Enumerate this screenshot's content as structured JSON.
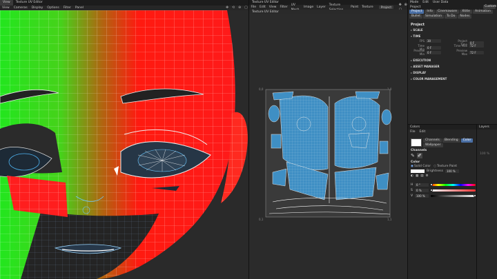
{
  "viewport": {
    "tabs": [
      "View",
      "Texture UV Editor"
    ],
    "menu": [
      "View",
      "Cameras",
      "Display",
      "Options",
      "Filter",
      "Panel"
    ],
    "label": "Perspective"
  },
  "uv_editor": {
    "title": "Texture UV Editor",
    "menu": [
      "File",
      "Edit",
      "View",
      "Filter",
      "UV Mesh",
      "Image",
      "Layer",
      "Texture Selection",
      "Paint",
      "Texture"
    ],
    "mode_select": "Project",
    "sub_label": "Texture UV Editor",
    "corners": {
      "top_left": "0,0",
      "top_right": "1,0",
      "bottom_left": "0,1",
      "bottom_right": "1,1"
    }
  },
  "attributes": {
    "top_tabs": [
      "Mode",
      "Edit",
      "User Data"
    ],
    "layout": "Custom",
    "project_label": "Project",
    "tabs": [
      "Project",
      "Info",
      "Cinemaware",
      "Xtitle",
      "Animation",
      "Bullet",
      "Simulation",
      "To Do",
      "Nodes"
    ],
    "title": "Project",
    "sections": {
      "scale": "SCALE",
      "time": "TIME",
      "execution": "EXECUTION",
      "asset_manager": "ASSET MANAGER",
      "display": "DISPLAY",
      "color_management": "COLOR MANAGEMENT"
    },
    "time_fields": [
      {
        "label": "FPS",
        "value": "30"
      },
      {
        "label": "Project Time",
        "value": "0 F"
      },
      {
        "label": "Time Min",
        "value": "0 F"
      },
      {
        "label": "Time Max",
        "value": "72 F"
      },
      {
        "label": "Preview Min",
        "value": "0 F"
      },
      {
        "label": "Preview Max",
        "value": "72 F"
      }
    ]
  },
  "colors_panel": {
    "tab": "Colors",
    "menu": [
      "File",
      "Edit"
    ],
    "buttons": [
      "Channels",
      "Blending",
      "Color"
    ],
    "wallpaper": "Wallpaper",
    "channels_label": "Channels",
    "color_label": "Color",
    "radio_solid": "Solid Color",
    "radio_texture": "Texture Paint",
    "brightness_label": "Brightness",
    "brightness_value": "100 %",
    "hue_label": "H",
    "hue_value": "0 °",
    "sat_label": "S",
    "sat_value": "0 %",
    "val_label": "V",
    "val_value": "100 %",
    "swatch_color": "#ffffff"
  },
  "layers_panel": {
    "tab": "Layers",
    "value": "100 %"
  },
  "colors": {
    "accent": "#4a6fa5",
    "uv_island": "#3f8fc4"
  }
}
